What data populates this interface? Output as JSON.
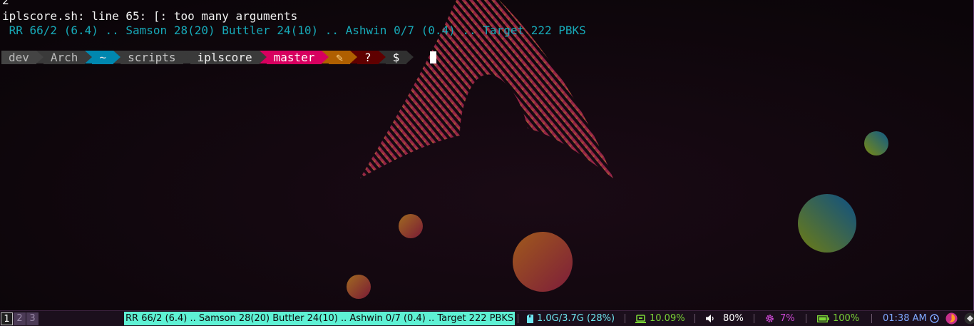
{
  "terminal": {
    "line_prev": "2",
    "error_line": "iplscore.sh: line 65: [: too many arguments",
    "score_line": " RR 66/2 (6.4) .. Samson 28(20) Buttler 24(10) .. Ashwin 0/7 (0.4) .. Target 222 PBKS",
    "prompt": {
      "segments": [
        {
          "text": "dev",
          "bg": "#444444",
          "fg": "#bcbcbc"
        },
        {
          "text": "Arch",
          "bg": "#3a3a3a",
          "fg": "#bcbcbc"
        },
        {
          "text": "~",
          "bg": "#0087af",
          "fg": "#e4e4e4"
        },
        {
          "text": "scripts",
          "bg": "#3a3a3a",
          "fg": "#c6c6c6"
        },
        {
          "text": "iplscore",
          "bg": "#3a3a3a",
          "fg": "#eeeeee"
        },
        {
          "text": "master",
          "bg": "#d7005f",
          "fg": "#ffffff"
        },
        {
          "text": "✎",
          "bg": "#af5f00",
          "fg": "#ffd787"
        },
        {
          "text": "?",
          "bg": "#5f0000",
          "fg": "#ffffff"
        },
        {
          "text": "$",
          "bg": "#303030",
          "fg": "#ffffff"
        }
      ]
    }
  },
  "statusbar": {
    "workspaces": [
      {
        "label": "1",
        "active": true
      },
      {
        "label": "2",
        "active": false
      },
      {
        "label": "3",
        "active": false
      }
    ],
    "title": "RR 66/2 (6.4) .. Samson 28(20) Buttler 24(10) .. Ashwin 0/7 (0.4) .. Target 222 PBKS",
    "memory": "1.0G/3.7G (28%)",
    "cpu": "10.09%",
    "volume": "80%",
    "temp": "7%",
    "battery": "100%",
    "clock": "01:38 AM",
    "colors": {
      "title_bg": "#5ef1d4",
      "memory": "#6ee6f0",
      "cpu": "#7ad336",
      "volume": "#ffffff",
      "temp": "#d04ad8",
      "battery": "#7ad336",
      "clock": "#7ea7ff"
    }
  }
}
